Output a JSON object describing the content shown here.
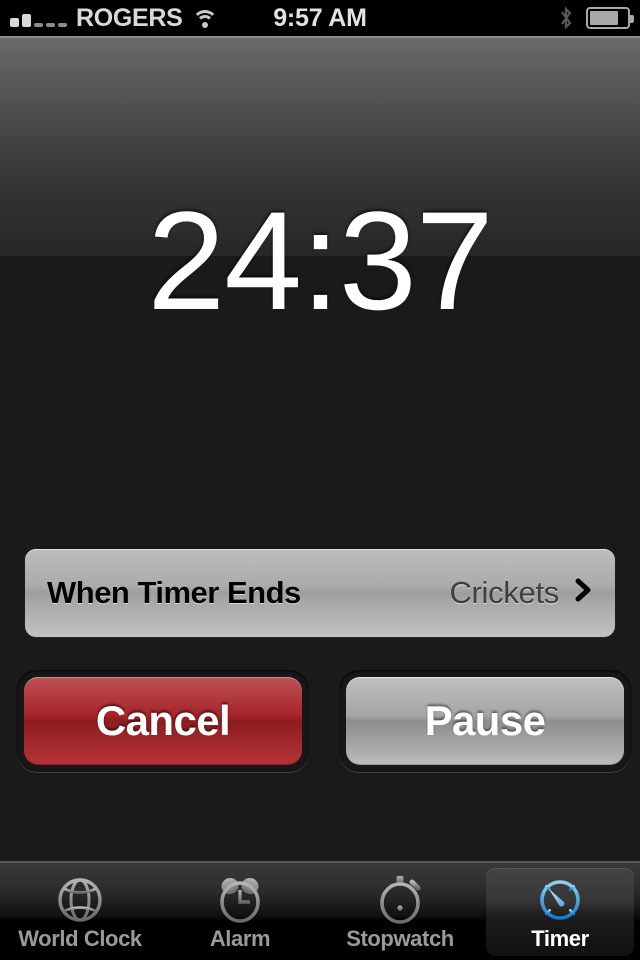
{
  "status_bar": {
    "carrier": "ROGERS",
    "time": "9:57 AM",
    "signal_bars_filled": 2,
    "signal_bars_total": 5,
    "wifi_icon": "wifi-icon",
    "bluetooth_icon": "bluetooth-icon",
    "battery_icon": "battery-icon",
    "battery_level_percent": 78
  },
  "timer": {
    "remaining": "24:37",
    "minutes": "24",
    "seconds": "37"
  },
  "sound_row": {
    "label": "When Timer Ends",
    "value": "Crickets",
    "chevron": "›"
  },
  "buttons": {
    "cancel": "Cancel",
    "pause": "Pause"
  },
  "tab_bar": {
    "items": [
      {
        "label": "World Clock",
        "icon": "globe-icon",
        "active": false
      },
      {
        "label": "Alarm",
        "icon": "alarm-clock-icon",
        "active": false
      },
      {
        "label": "Stopwatch",
        "icon": "stopwatch-icon",
        "active": false
      },
      {
        "label": "Timer",
        "icon": "timer-icon",
        "active": true
      }
    ]
  },
  "colors": {
    "accent_blue": "#4aa8e0",
    "cancel_red": "#a62428",
    "pause_gray": "#a5a5a5",
    "background": "#1a1a1a",
    "text_light": "#ffffff",
    "tab_inactive": "#9a9a9a"
  }
}
